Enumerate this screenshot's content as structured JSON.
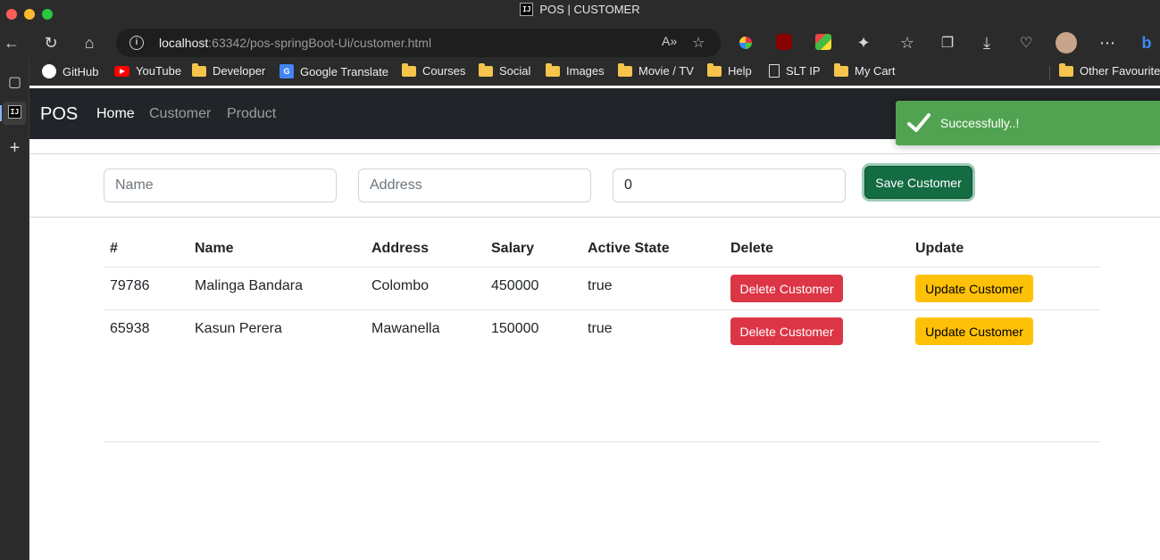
{
  "window": {
    "title": "POS | CUSTOMER",
    "app_badge": "IJ"
  },
  "browser": {
    "url_host": "localhost",
    "url_rest": ":63342/pos-springBoot-Ui/customer.html"
  },
  "bookmarks": [
    {
      "label": "GitHub",
      "icon": "github-icon"
    },
    {
      "label": "YouTube",
      "icon": "youtube-icon"
    },
    {
      "label": "Developer",
      "icon": "folder-icon"
    },
    {
      "label": "Google Translate",
      "icon": "google-translate-icon"
    },
    {
      "label": "Courses",
      "icon": "folder-icon"
    },
    {
      "label": "Social",
      "icon": "folder-icon"
    },
    {
      "label": "Images",
      "icon": "folder-icon"
    },
    {
      "label": "Movie / TV",
      "icon": "folder-icon"
    },
    {
      "label": "Help",
      "icon": "folder-icon"
    },
    {
      "label": "SLT IP",
      "icon": "document-icon"
    },
    {
      "label": "My Cart",
      "icon": "folder-icon"
    },
    {
      "label": "Other Favourites",
      "icon": "folder-icon"
    }
  ],
  "navbar": {
    "brand": "POS",
    "links": [
      {
        "label": "Home",
        "active": true
      },
      {
        "label": "Customer",
        "active": false
      },
      {
        "label": "Product",
        "active": false
      }
    ]
  },
  "toast": {
    "message": "Successfully..!",
    "color": "#51a351"
  },
  "form": {
    "name_placeholder": "Name",
    "address_placeholder": "Address",
    "salary_value": "0",
    "save_label": "Save Customer"
  },
  "table": {
    "headers": [
      "#",
      "Name",
      "Address",
      "Salary",
      "Active State",
      "Delete",
      "Update"
    ],
    "rows": [
      {
        "id": "79786",
        "name": "Malinga Bandara",
        "address": "Colombo",
        "salary": "450000",
        "active": "true",
        "delete_label": "Delete Customer",
        "update_label": "Update Customer"
      },
      {
        "id": "65938",
        "name": "Kasun Perera",
        "address": "Mawanella",
        "salary": "150000",
        "active": "true",
        "delete_label": "Delete Customer",
        "update_label": "Update Customer"
      }
    ]
  },
  "colors": {
    "navbar": "#212529",
    "danger": "#dc3545",
    "warning": "#ffc107",
    "success": "#146c43"
  }
}
